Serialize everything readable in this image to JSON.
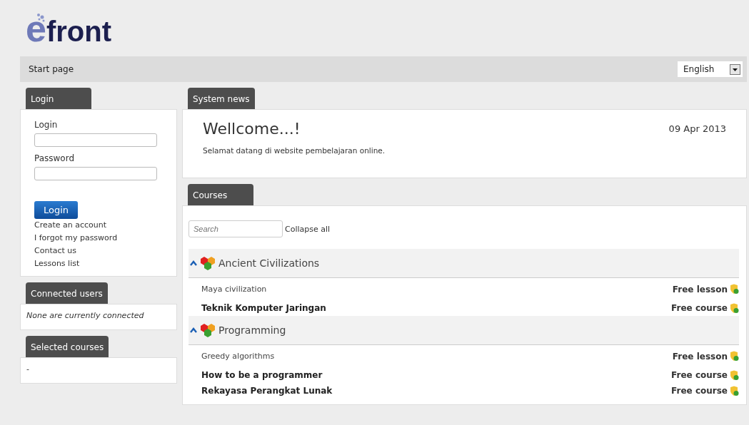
{
  "logo": {
    "mark": "e",
    "word": "front"
  },
  "nav": {
    "title": "Start page",
    "language": "English"
  },
  "login": {
    "tab": "Login",
    "login_label": "Login",
    "password_label": "Password",
    "button": "Login",
    "links": [
      "Create an account",
      "I forgot my password",
      "Contact us",
      "Lessons list"
    ]
  },
  "connected_users": {
    "tab": "Connected users",
    "text": "None are currently connected"
  },
  "selected_courses": {
    "tab": "Selected courses",
    "text": "-"
  },
  "system_news": {
    "tab": "System news",
    "title": "Wellcome...!",
    "date": "09 Apr 2013",
    "body": "Selamat datang di website pembelajaran online."
  },
  "courses": {
    "tab": "Courses",
    "search": {
      "placeholder": "Search"
    },
    "collapse": "Collapse all",
    "categories": [
      {
        "name": "Ancient Civilizations",
        "expanded": true,
        "items": [
          {
            "kind": "lesson",
            "name": "Maya civilization",
            "badge": "Free lesson"
          },
          {
            "kind": "course",
            "name": "Teknik Komputer Jaringan",
            "badge": "Free course"
          }
        ]
      },
      {
        "name": "Programming",
        "expanded": true,
        "items": [
          {
            "kind": "lesson",
            "name": "Greedy algorithms",
            "badge": "Free lesson"
          },
          {
            "kind": "course",
            "name": "How to be a programmer",
            "badge": "Free course"
          },
          {
            "kind": "course",
            "name": "Rekayasa Perangkat Lunak",
            "badge": "Free course"
          }
        ]
      }
    ]
  }
}
